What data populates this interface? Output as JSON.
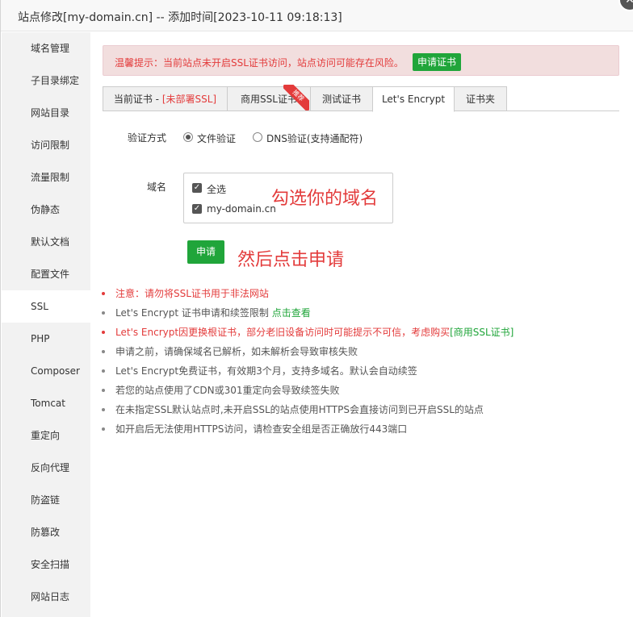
{
  "window": {
    "title": "站点修改[my-domain.cn] -- 添加时间[2023-10-11 09:18:13]",
    "close_glyph": "✕"
  },
  "sidebar": {
    "items": [
      {
        "label": "域名管理"
      },
      {
        "label": "子目录绑定"
      },
      {
        "label": "网站目录"
      },
      {
        "label": "访问限制"
      },
      {
        "label": "流量限制"
      },
      {
        "label": "伪静态"
      },
      {
        "label": "默认文档"
      },
      {
        "label": "配置文件"
      },
      {
        "label": "SSL",
        "active": true
      },
      {
        "label": "PHP"
      },
      {
        "label": "Composer"
      },
      {
        "label": "Tomcat"
      },
      {
        "label": "重定向"
      },
      {
        "label": "反向代理"
      },
      {
        "label": "防盗链"
      },
      {
        "label": "防篡改"
      },
      {
        "label": "安全扫描"
      },
      {
        "label": "网站日志"
      }
    ]
  },
  "alert": {
    "text": "温馨提示：当前站点未开启SSL证书访问，站点访问可能存在风险。",
    "button": "申请证书"
  },
  "tabs": {
    "current": {
      "prefix": "当前证书 - ",
      "status": "[未部署SSL]"
    },
    "commercial": "商用SSL证书",
    "ribbon": "推荐",
    "test": "测试证书",
    "letsencrypt": "Let's Encrypt",
    "folder": "证书夹"
  },
  "form": {
    "verify_label": "验证方式",
    "verify_file": "文件验证",
    "verify_dns": "DNS验证(支持通配符)",
    "domain_label": "域名",
    "select_all": "全选",
    "domain": "my-domain.cn",
    "submit": "申请",
    "check_glyph": "✓"
  },
  "annotations": {
    "select_domain": "勾选你的域名",
    "then_apply": "然后点击申请"
  },
  "notes": {
    "n1": "注意：请勿将SSL证书用于非法网站",
    "n2_text": "Let's Encrypt 证书申请和续签限制 ",
    "n2_link": "点击查看",
    "n3_text": "Let's Encrypt因更换根证书，部分老旧设备访问时可能提示不可信，考虑购买",
    "n3_link": "[商用SSL证书]",
    "n4": "申请之前，请确保域名已解析，如未解析会导致审核失败",
    "n5": "Let's Encrypt免费证书，有效期3个月，支持多域名。默认会自动续签",
    "n6": "若您的站点使用了CDN或301重定向会导致续签失败",
    "n7": "在未指定SSL默认站点时,未开启SSL的站点使用HTTPS会直接访问到已开启SSL的站点",
    "n8": "如开启后无法使用HTTPS访问，请检查安全组是否正确放行443端口"
  },
  "colors": {
    "accent_green": "#20a53a",
    "warning_red": "#e33b3b",
    "alert_bg": "#f2dede"
  }
}
